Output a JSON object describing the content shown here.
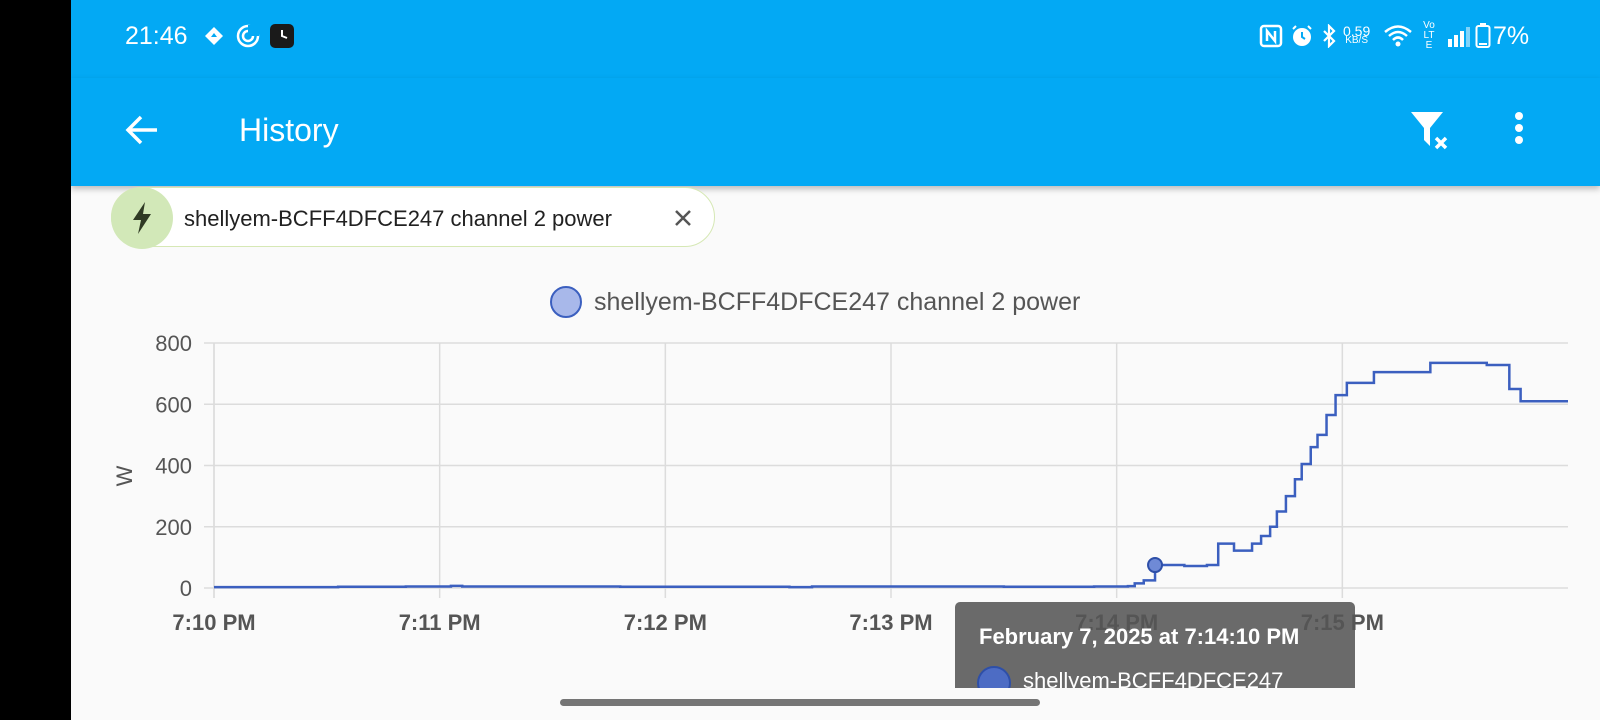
{
  "status_bar": {
    "time": "21:46",
    "data_speed_value": "0.59",
    "data_speed_unit": "KB/S",
    "volte_label": "Vo LTE",
    "battery": "7%",
    "left_icons": [
      "navigation-icon",
      "sync-icon",
      "watch-app-icon"
    ],
    "right_icons": [
      "nfc-icon",
      "alarm-icon",
      "bluetooth-icon",
      "wifi-icon",
      "signal-icon",
      "battery-icon"
    ]
  },
  "app_bar": {
    "title": "History",
    "back_icon": "arrow-back-icon",
    "filter_icon": "filter-remove-icon",
    "menu_icon": "more-vert-icon"
  },
  "entity_chip": {
    "label": "shellyem-BCFF4DFCE247 channel 2 power",
    "icon": "lightning-bolt-icon"
  },
  "colors": {
    "accent": "#03a9f4",
    "series": "#3b5fbf",
    "series_fill": "#a8b8ea",
    "chip_avatar": "#d2e8b8"
  },
  "tooltip": {
    "title": "February 7, 2025 at 7:14:10 PM",
    "series_label": "shellyem-BCFF4DFCE247"
  },
  "chart_data": {
    "type": "line",
    "step": true,
    "legend": "top-center",
    "grid": true,
    "ylabel": "W",
    "ylim": [
      0,
      800
    ],
    "yticks": [
      "0",
      "200",
      "400",
      "600",
      "800"
    ],
    "xlim": [
      0,
      6.0
    ],
    "xticks": [
      {
        "t": 0,
        "label": "7:10 PM"
      },
      {
        "t": 1,
        "label": "7:11 PM"
      },
      {
        "t": 2,
        "label": "7:12 PM"
      },
      {
        "t": 3,
        "label": "7:13 PM"
      },
      {
        "t": 4,
        "label": "7:14 PM"
      },
      {
        "t": 5,
        "label": "7:15 PM"
      }
    ],
    "highlight": {
      "t": 4.17,
      "v": 75
    },
    "series": [
      {
        "name": "shellyem-BCFF4DFCE247 channel 2 power",
        "points": [
          [
            0,
            3
          ],
          [
            0.55,
            4
          ],
          [
            0.85,
            5
          ],
          [
            1.05,
            7
          ],
          [
            1.1,
            5
          ],
          [
            1.8,
            4
          ],
          [
            2.55,
            3
          ],
          [
            2.65,
            5
          ],
          [
            3.5,
            4
          ],
          [
            3.9,
            5
          ],
          [
            4.05,
            6
          ],
          [
            4.08,
            15
          ],
          [
            4.12,
            25
          ],
          [
            4.17,
            75
          ],
          [
            4.3,
            72
          ],
          [
            4.4,
            75
          ],
          [
            4.45,
            145
          ],
          [
            4.52,
            122
          ],
          [
            4.6,
            145
          ],
          [
            4.64,
            170
          ],
          [
            4.68,
            200
          ],
          [
            4.71,
            250
          ],
          [
            4.75,
            300
          ],
          [
            4.79,
            355
          ],
          [
            4.82,
            405
          ],
          [
            4.86,
            460
          ],
          [
            4.89,
            500
          ],
          [
            4.93,
            565
          ],
          [
            4.97,
            630
          ],
          [
            5.02,
            670
          ],
          [
            5.14,
            705
          ],
          [
            5.39,
            735
          ],
          [
            5.64,
            728
          ],
          [
            5.74,
            650
          ],
          [
            5.79,
            610
          ],
          [
            6.0,
            610
          ]
        ]
      }
    ]
  }
}
